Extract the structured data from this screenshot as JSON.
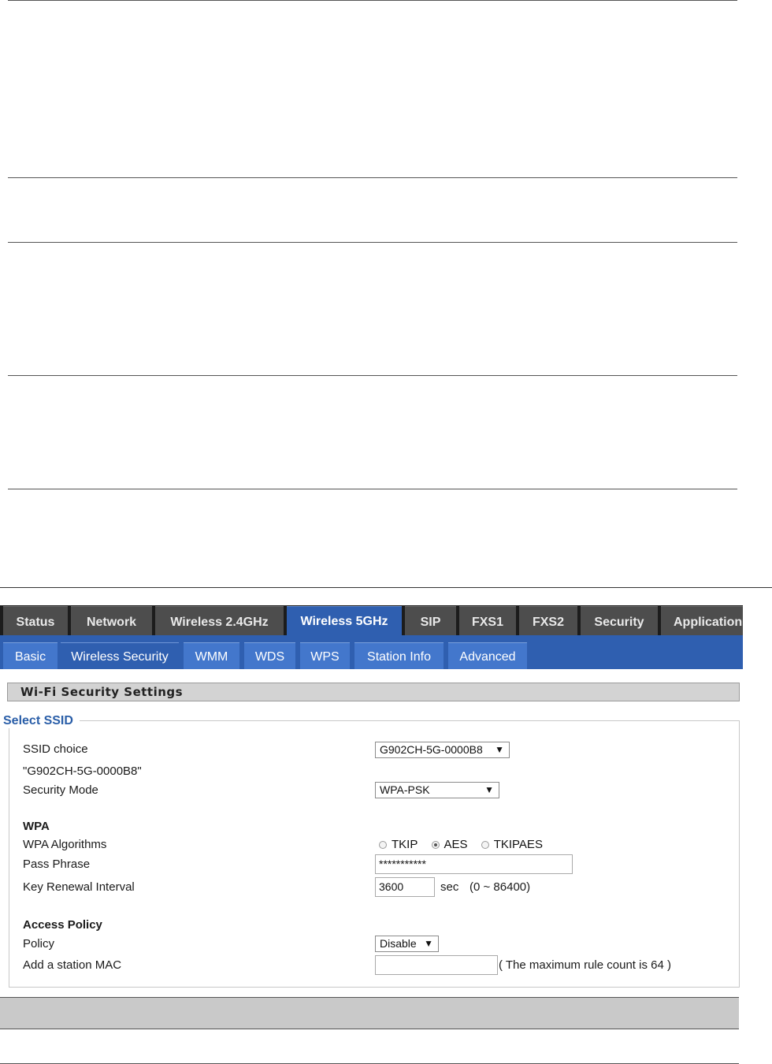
{
  "top_tabs": [
    {
      "label": "Status"
    },
    {
      "label": "Network"
    },
    {
      "label": "Wireless 2.4GHz"
    },
    {
      "label": "Wireless 5GHz"
    },
    {
      "label": "SIP"
    },
    {
      "label": "FXS1"
    },
    {
      "label": "FXS2"
    },
    {
      "label": "Security"
    },
    {
      "label": "Application"
    }
  ],
  "sub_tabs": [
    {
      "label": "Basic"
    },
    {
      "label": "Wireless Security"
    },
    {
      "label": "WMM"
    },
    {
      "label": "WDS"
    },
    {
      "label": "WPS"
    },
    {
      "label": "Station Info"
    },
    {
      "label": "Advanced"
    }
  ],
  "section_title": "Wi-Fi Security Settings",
  "legend": "Select SSID",
  "ssid": {
    "label": "SSID choice",
    "selected": "G902CH-5G-0000B8",
    "quoted_name": "\"G902CH-5G-0000B8\""
  },
  "security_mode": {
    "label": "Security Mode",
    "selected": "WPA-PSK"
  },
  "wpa": {
    "heading": "WPA",
    "algorithms_label": "WPA Algorithms",
    "algorithms": [
      {
        "label": "TKIP",
        "checked": false
      },
      {
        "label": "AES",
        "checked": true
      },
      {
        "label": "TKIPAES",
        "checked": false
      }
    ],
    "pass_label": "Pass Phrase",
    "pass_value": "***********",
    "renewal_label": "Key Renewal Interval",
    "renewal_value": "3600",
    "renewal_unit": "sec",
    "renewal_range": "(0 ~ 86400)"
  },
  "access_policy": {
    "heading": "Access Policy",
    "policy_label": "Policy",
    "policy_value": "Disable",
    "mac_label": "Add a station MAC",
    "mac_value": "",
    "mac_note": "( The maximum rule count is 64 )"
  },
  "colors": {
    "active_tab": "#2f5fb0",
    "subbar": "#2f5fb0",
    "legend": "#2a5ea8"
  },
  "icons": {
    "dropdown": "triangle-down"
  }
}
